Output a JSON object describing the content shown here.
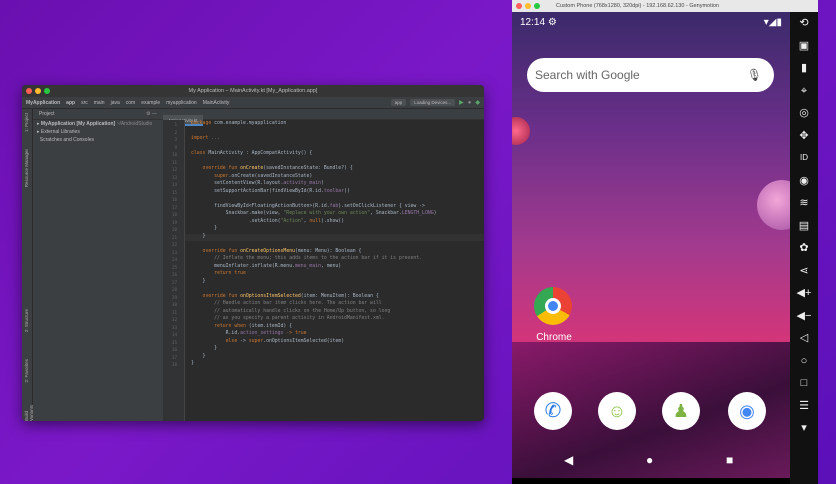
{
  "ide": {
    "title": "My Application – MainActivity.kt [My_Application.app]",
    "breadcrumbs": [
      "MyApplication",
      "app",
      "src",
      "main",
      "java",
      "com",
      "example",
      "myapplication",
      "MainActivity"
    ],
    "run_config": "app",
    "device": "Loading Devices...",
    "project_label": "Project",
    "tree": [
      "MyApplication [My Application]",
      "External Libraries",
      "Scratches and Consoles"
    ],
    "tree_hint": "~/AndroidStudio",
    "side_labels": [
      "1: Project",
      "Resource Manager",
      "2: Structure",
      "2: Favorites",
      "Build Variants"
    ],
    "tab": "MainActivity.kt",
    "current_line": 21,
    "code": [
      {
        "n": "1",
        "s": [
          [
            "kw",
            "package "
          ],
          [
            "",
            "com.example.myapplication"
          ]
        ]
      },
      {
        "n": "2",
        "s": []
      },
      {
        "n": "3",
        "s": [
          [
            "kw",
            "import "
          ],
          [
            "cm",
            "..."
          ]
        ]
      },
      {
        "n": "9",
        "s": []
      },
      {
        "n": "10",
        "s": [
          [
            "kw",
            "class "
          ],
          [
            "",
            "MainActivity : AppCompatActivity() {"
          ]
        ]
      },
      {
        "n": "11",
        "s": []
      },
      {
        "n": "12",
        "s": [
          [
            "kw",
            "    override fun "
          ],
          [
            "fn",
            "onCreate"
          ],
          [
            "",
            "(savedInstanceState: Bundle?) {"
          ]
        ]
      },
      {
        "n": "13",
        "s": [
          [
            "kw",
            "        super"
          ],
          [
            "",
            ".onCreate(savedInstanceState)"
          ]
        ]
      },
      {
        "n": "14",
        "s": [
          [
            "",
            "        setContentView(R.layout."
          ],
          [
            "pu",
            "activity_main"
          ],
          [
            "",
            ")"
          ]
        ]
      },
      {
        "n": "15",
        "s": [
          [
            "",
            "        setSupportActionBar(findViewById(R.id."
          ],
          [
            "pu",
            "toolbar"
          ],
          [
            "",
            "))"
          ]
        ]
      },
      {
        "n": "16",
        "s": []
      },
      {
        "n": "17",
        "s": [
          [
            "",
            "        findViewById<FloatingActionButton>(R.id."
          ],
          [
            "pu",
            "fab"
          ],
          [
            "",
            ").setOnClickListener { view ->"
          ]
        ]
      },
      {
        "n": "18",
        "s": [
          [
            "",
            "            Snackbar.make(view, "
          ],
          [
            "str",
            "\"Replace with your own action\""
          ],
          [
            "",
            ", Snackbar."
          ],
          [
            "pu",
            "LENGTH_LONG"
          ],
          [
            "",
            ")"
          ]
        ]
      },
      {
        "n": "19",
        "s": [
          [
            "",
            "                    .setAction("
          ],
          [
            "str",
            "\"Action\""
          ],
          [
            "",
            ", "
          ],
          [
            "kw",
            "null"
          ],
          [
            "",
            ").show()"
          ]
        ]
      },
      {
        "n": "20",
        "s": [
          [
            "",
            "        }"
          ]
        ]
      },
      {
        "n": "21",
        "s": [
          [
            "",
            "    }"
          ]
        ]
      },
      {
        "n": "22",
        "s": []
      },
      {
        "n": "23",
        "s": [
          [
            "kw",
            "    override fun "
          ],
          [
            "fn",
            "onCreateOptionsMenu"
          ],
          [
            "",
            "(menu: Menu): Boolean {"
          ]
        ]
      },
      {
        "n": "24",
        "s": [
          [
            "cm",
            "        // Inflate the menu; this adds items to the action bar if it is present."
          ]
        ]
      },
      {
        "n": "25",
        "s": [
          [
            "",
            "        menuInflater.inflate(R.menu."
          ],
          [
            "pu",
            "menu_main"
          ],
          [
            "",
            ", menu)"
          ]
        ]
      },
      {
        "n": "26",
        "s": [
          [
            "kw",
            "        return true"
          ]
        ]
      },
      {
        "n": "27",
        "s": [
          [
            "",
            "    }"
          ]
        ]
      },
      {
        "n": "28",
        "s": []
      },
      {
        "n": "29",
        "s": [
          [
            "kw",
            "    override fun "
          ],
          [
            "fn",
            "onOptionsItemSelected"
          ],
          [
            "",
            "(item: MenuItem): Boolean {"
          ]
        ]
      },
      {
        "n": "30",
        "s": [
          [
            "cm",
            "        // Handle action bar item clicks here. The action bar will"
          ]
        ]
      },
      {
        "n": "31",
        "s": [
          [
            "cm",
            "        // automatically handle clicks on the Home/Up button, so long"
          ]
        ]
      },
      {
        "n": "32",
        "s": [
          [
            "cm",
            "        // as you specify a parent activity in AndroidManifest.xml."
          ]
        ]
      },
      {
        "n": "33",
        "s": [
          [
            "kw",
            "        return when "
          ],
          [
            "",
            "(item.itemId) {"
          ]
        ]
      },
      {
        "n": "34",
        "s": [
          [
            "",
            "            R.id."
          ],
          [
            "pu",
            "action_settings"
          ],
          [
            "kw",
            " -> true"
          ]
        ]
      },
      {
        "n": "35",
        "s": [
          [
            "kw",
            "            else "
          ],
          [
            "",
            "-> "
          ],
          [
            "kw",
            "super"
          ],
          [
            "",
            ".onOptionsItemSelected(item)"
          ]
        ]
      },
      {
        "n": "36",
        "s": [
          [
            "",
            "        }"
          ]
        ]
      },
      {
        "n": "37",
        "s": [
          [
            "",
            "    }"
          ]
        ]
      },
      {
        "n": "38",
        "s": [
          [
            "",
            "}"
          ]
        ]
      }
    ]
  },
  "phone": {
    "title": "Custom Phone (768x1280, 320dpi) - 192.168.62.130 - Genymotion",
    "time": "12:14",
    "search_placeholder": "Search with Google",
    "chrome_label": "Chrome",
    "toolbar_icons": [
      "rotate",
      "screen-record",
      "battery",
      "gps",
      "webcam",
      "dpad",
      "device-id",
      "disk-io",
      "cast",
      "sms",
      "opengapps",
      "share",
      "volume-up",
      "volume-down",
      "back",
      "home",
      "recents",
      "menu",
      "more"
    ]
  }
}
